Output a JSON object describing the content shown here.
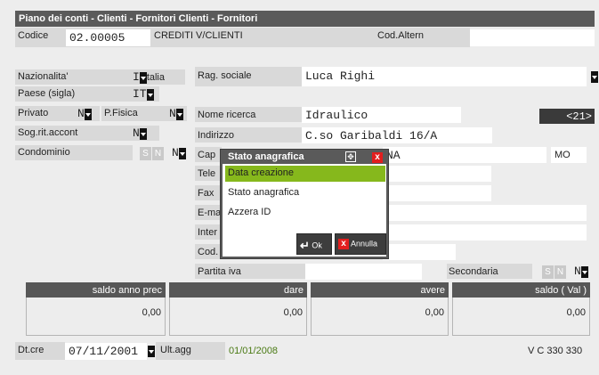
{
  "title": "Piano dei conti - Clienti - Fornitori  Clienti - Fornitori",
  "codice": {
    "label": "Codice",
    "value": "02.00005",
    "desc": "CREDITI V/CLIENTI"
  },
  "cod_altern": {
    "label": "Cod.Altern",
    "value": ""
  },
  "left": {
    "nazionalita": {
      "label": "Nazionalita'",
      "value": "I",
      "text": "talia"
    },
    "paese": {
      "label": "Paese (sigla)",
      "value": "IT"
    },
    "privato": {
      "label": "Privato",
      "value": "N"
    },
    "pfisica": {
      "label": "P.Fisica",
      "value": "N"
    },
    "sog_rit": {
      "label": "Sog.rit.accont",
      "value": "N"
    },
    "condominio": {
      "label": "Condominio",
      "s": "S",
      "n": "N",
      "value": "N"
    }
  },
  "right": {
    "rag_sociale": {
      "label": "Rag. sociale",
      "value": "Luca Righi"
    },
    "nome_ricerca": {
      "label": "Nome ricerca",
      "value": "Idraulico"
    },
    "badge": "<21>",
    "indirizzo": {
      "label": "Indirizzo",
      "value": "C.so Garibaldi 16/A"
    },
    "cap": {
      "label": "Cap",
      "city": "NA",
      "prov": "MO"
    },
    "tele": {
      "label": "Tele"
    },
    "fax": {
      "label": "Fax"
    },
    "email": {
      "label": "E-ma"
    },
    "inter": {
      "label": "Inter"
    },
    "cod": {
      "label": "Cod."
    },
    "partita_iva": {
      "label": "Partita iva",
      "value": ""
    },
    "secondaria": {
      "label": "Secondaria",
      "s": "S",
      "n": "N",
      "value": "N"
    }
  },
  "dialog": {
    "title": "Stato anagrafica",
    "items": [
      "Data creazione",
      "Stato anagrafica",
      "Azzera ID"
    ],
    "ok": "Ok",
    "annulla": "Annulla",
    "selected_color": "#86b81c"
  },
  "summary": [
    {
      "header": "saldo anno prec",
      "value": "0,00"
    },
    {
      "header": "dare",
      "value": "0,00"
    },
    {
      "header": "avere",
      "value": "0,00"
    },
    {
      "header": "saldo ( Val )",
      "value": "0,00"
    }
  ],
  "footer": {
    "dtcre_label": "Dt.cre",
    "dtcre_value": "07/11/2001",
    "ultagg_label": "Ult.agg",
    "ultagg_value": "01/01/2008",
    "version": "V C 330 330",
    "date_color": "#4a7a14"
  }
}
